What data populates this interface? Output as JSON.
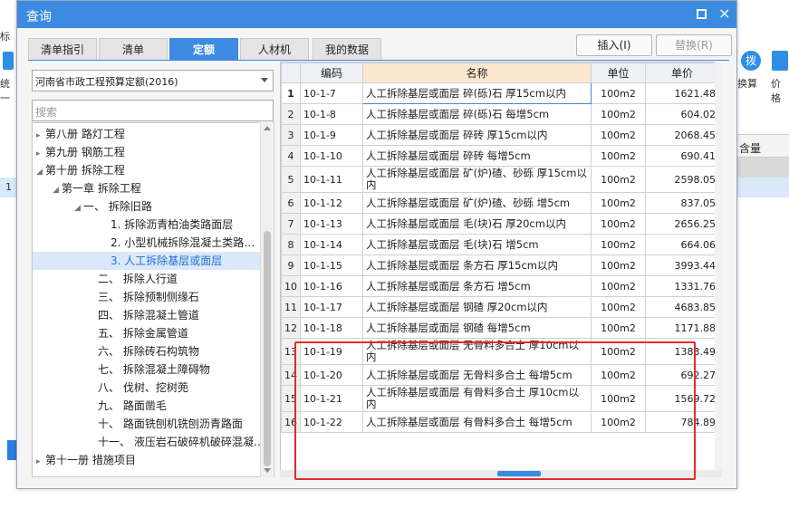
{
  "background": {
    "left_label_top": "标",
    "left_label_mid": "统一",
    "left_row_num": "1",
    "right_btn1_label": "换算",
    "right_btn2_label": "价格",
    "right_header": "含量"
  },
  "dialog": {
    "title": "查询",
    "max_icon": "maximize-icon",
    "close_icon": "close-icon",
    "close_glyph": "×",
    "tabs": [
      "清单指引",
      "清单",
      "定额",
      "人材机",
      "我的数据"
    ],
    "active_tab": "定额",
    "insert_button": "插入(I)",
    "replace_button": "替换(R)"
  },
  "left": {
    "region": "河南省市政工程预算定额(2016)",
    "search_placeholder": "搜索",
    "tree": [
      {
        "label": "第八册 路灯工程",
        "toggle": "▸"
      },
      {
        "label": "第九册 钢筋工程",
        "toggle": "▸"
      },
      {
        "label": "第十册 拆除工程",
        "toggle": "◢"
      },
      {
        "label": "第一章 拆除工程",
        "toggle": "◢"
      },
      {
        "label": "一、 拆除旧路",
        "toggle": "◢"
      },
      {
        "label": "1. 拆除沥青柏油类路面层",
        "toggle": ""
      },
      {
        "label": "2. 小型机械拆除混凝土类路…",
        "toggle": ""
      },
      {
        "label": "3. 人工拆除基层或面层",
        "toggle": "",
        "selected": true
      },
      {
        "label": "二、 拆除人行道",
        "toggle": ""
      },
      {
        "label": "三、 拆除预制侧缘石",
        "toggle": ""
      },
      {
        "label": "四、 拆除混凝土管道",
        "toggle": ""
      },
      {
        "label": "五、 拆除金属管道",
        "toggle": ""
      },
      {
        "label": "六、 拆除砖石构筑物",
        "toggle": ""
      },
      {
        "label": "七、 拆除混凝土障碍物",
        "toggle": ""
      },
      {
        "label": "八、 伐树、挖树蔸",
        "toggle": ""
      },
      {
        "label": "九、 路面凿毛",
        "toggle": ""
      },
      {
        "label": "十、 路面铣刨机铣刨沥青路面",
        "toggle": ""
      },
      {
        "label": "十一、 液压岩石破碎机破碎混凝…",
        "toggle": ""
      },
      {
        "label": "第十一册 措施项目",
        "toggle": "▸"
      }
    ]
  },
  "grid": {
    "columns": [
      "",
      "编码",
      "名称",
      "单位",
      "单价"
    ],
    "rows": [
      {
        "num": "1",
        "code": "10-1-7",
        "name": "人工拆除基层或面层 碎(砾)石 厚15cm以内",
        "unit": "100m2",
        "price": "1621.48"
      },
      {
        "num": "2",
        "code": "10-1-8",
        "name": "人工拆除基层或面层 碎(砾)石 每增5cm",
        "unit": "100m2",
        "price": "604.02"
      },
      {
        "num": "3",
        "code": "10-1-9",
        "name": "人工拆除基层或面层 碎砖 厚15cm以内",
        "unit": "100m2",
        "price": "2068.45"
      },
      {
        "num": "4",
        "code": "10-1-10",
        "name": "人工拆除基层或面层 碎砖 每增5cm",
        "unit": "100m2",
        "price": "690.41"
      },
      {
        "num": "5",
        "code": "10-1-11",
        "name": "人工拆除基层或面层 矿(炉)碴、砂砾 厚15cm以内",
        "unit": "100m2",
        "price": "2598.05"
      },
      {
        "num": "6",
        "code": "10-1-12",
        "name": "人工拆除基层或面层 矿(炉)碴、砂砾 增5cm",
        "unit": "100m2",
        "price": "837.05"
      },
      {
        "num": "7",
        "code": "10-1-13",
        "name": "人工拆除基层或面层 毛(块)石 厚20cm以内",
        "unit": "100m2",
        "price": "2656.25"
      },
      {
        "num": "8",
        "code": "10-1-14",
        "name": "人工拆除基层或面层 毛(块)石 增5cm",
        "unit": "100m2",
        "price": "664.06"
      },
      {
        "num": "9",
        "code": "10-1-15",
        "name": "人工拆除基层或面层 条方石 厚15cm以内",
        "unit": "100m2",
        "price": "3993.44"
      },
      {
        "num": "10",
        "code": "10-1-16",
        "name": "人工拆除基层或面层 条方石 增5cm",
        "unit": "100m2",
        "price": "1331.76"
      },
      {
        "num": "11",
        "code": "10-1-17",
        "name": "人工拆除基层或面层 钢碴 厚20cm以内",
        "unit": "100m2",
        "price": "4683.85"
      },
      {
        "num": "12",
        "code": "10-1-18",
        "name": "人工拆除基层或面层 钢碴 每增5cm",
        "unit": "100m2",
        "price": "1171.88"
      },
      {
        "num": "13",
        "code": "10-1-19",
        "name": "人工拆除基层或面层 无骨料多合土 厚10cm以内",
        "unit": "100m2",
        "price": "1383.49"
      },
      {
        "num": "14",
        "code": "10-1-20",
        "name": "人工拆除基层或面层 无骨料多合土 每增5cm",
        "unit": "100m2",
        "price": "692.27"
      },
      {
        "num": "15",
        "code": "10-1-21",
        "name": "人工拆除基层或面层 有骨料多合土 厚10cm以内",
        "unit": "100m2",
        "price": "1569.72"
      },
      {
        "num": "16",
        "code": "10-1-22",
        "name": "人工拆除基层或面层 有骨料多合土 每增5cm",
        "unit": "100m2",
        "price": "784.89"
      }
    ]
  },
  "colors": {
    "accent": "#3c8be0",
    "highlight_box": "#e12b2b",
    "name_header": "#fbe8cf"
  }
}
